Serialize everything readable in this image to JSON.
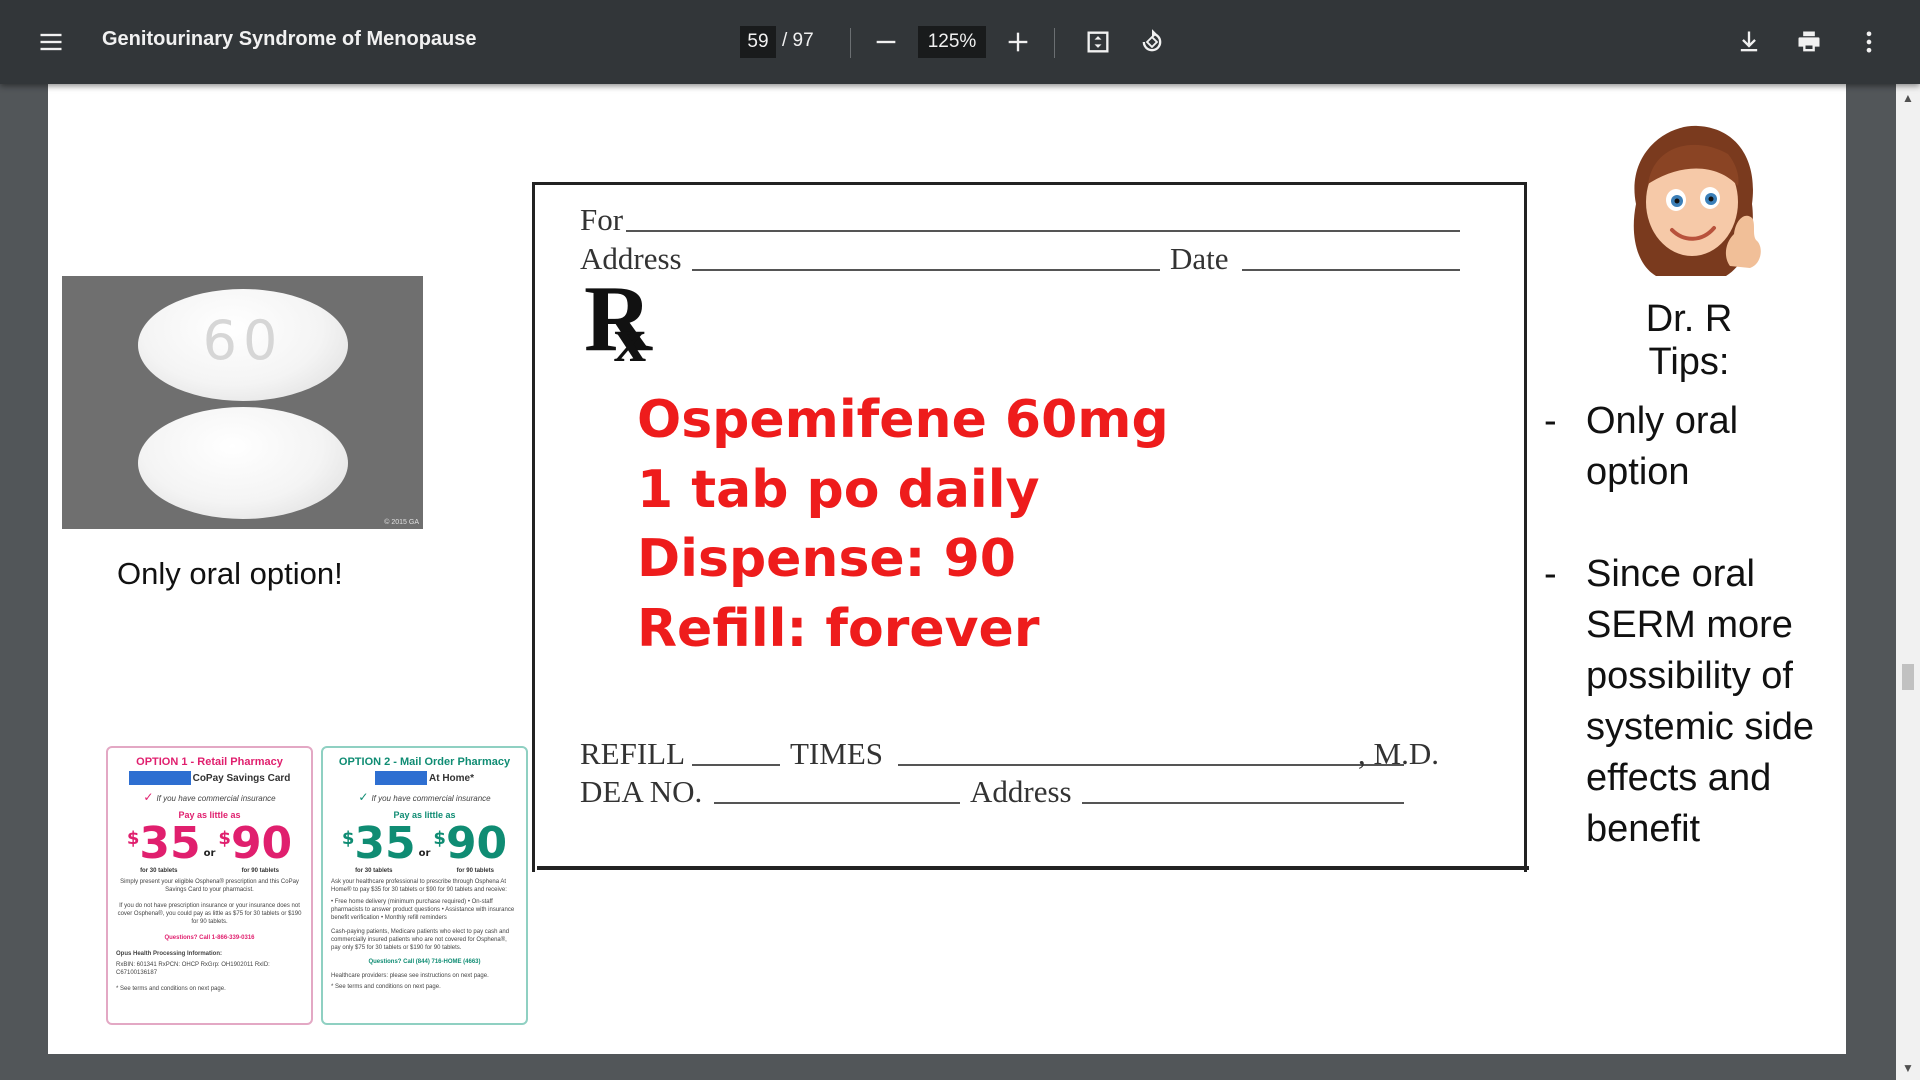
{
  "toolbar": {
    "menu_icon": "hamburger-menu-icon",
    "title": "Genitourinary Syndrome of Menopause",
    "current_page": "59",
    "total_pages": "/ 97",
    "zoom": "125%",
    "icons": [
      "zoom-out-icon",
      "zoom-in-icon",
      "fit-page-icon",
      "rotate-icon",
      "download-icon",
      "print-icon",
      "more-options-icon"
    ]
  },
  "slide": {
    "pill_photo": {
      "imprint": "60",
      "credit": "© 2015 GA"
    },
    "oral_caption": "Only oral option!",
    "rx_pad": {
      "for_label": "For",
      "address_label": "Address",
      "date_label": "Date",
      "rx_symbol": "R",
      "rx_symbol_x": "x",
      "refill_label": "REFILL",
      "times_label": "TIMES",
      "md_label": ", M.D.",
      "dea_label": "DEA NO.",
      "address2_label": "Address",
      "lines": [
        "Ospemifene 60mg",
        "1 tab po daily",
        "Dispense: 90",
        "Refill: forever"
      ]
    },
    "coupons": [
      {
        "title": "OPTION 1 - Retail Pharmacy",
        "subtitle": "CoPay Savings Card",
        "check": "If you have commercial insurance",
        "pay_label": "Pay as little as",
        "price1": "35",
        "price2": "90",
        "currency": "$",
        "or": "or",
        "tabs1": "for 30 tablets",
        "tabs2": "for 90 tablets",
        "fine1": "Simply present your eligible Osphena® prescription and this CoPay Savings Card to your pharmacist.",
        "fine2": "If you do not have prescription insurance or your insurance does not cover Osphena®, you could pay as little as $75 for 30 tablets or $190 for 90 tablets.",
        "questions": "Questions? Call 1-866-339-0316",
        "processing": "Opus Health Processing Information:",
        "ids": "RxBIN: 601341   RxPCN: OHCP   RxGrp: OH1902011   RxID: C67100136187",
        "terms": "* See terms and conditions on next page."
      },
      {
        "title": "OPTION 2 - Mail Order Pharmacy",
        "subtitle": "At Home*",
        "check": "If you have commercial insurance",
        "pay_label": "Pay as little as",
        "price1": "35",
        "price2": "90",
        "currency": "$",
        "or": "or",
        "tabs1": "for 30 tablets",
        "tabs2": "for 90 tablets",
        "fine1": "Ask your healthcare professional to prescribe through Osphena At Home® to pay $35 for 30 tablets or $90 for 90 tablets and receive:",
        "bullets": "• Free home delivery (minimum purchase required)  • On-staff pharmacists to answer product questions  • Assistance with insurance benefit verification  • Monthly refill reminders",
        "fine2": "Cash-paying patients, Medicare patients who elect to pay cash and commercially insured patients who are not covered for Osphena®, pay only $75 for 30 tablets or $190 for 90 tablets.",
        "questions": "Questions? Call (844) 716-HOME (4663)",
        "processing": "Healthcare providers: please see instructions on next page.",
        "terms": "* See terms and conditions on next page."
      }
    ],
    "avatar_icon": "memoji-thumbs-up-avatar-icon",
    "tips_heading": "Dr. R Tips:",
    "tips": [
      {
        "dash": "-",
        "text": "Only oral option"
      },
      {
        "dash": "-",
        "text": "Since oral SERM more possibility of systemic side effects and benefit"
      }
    ]
  },
  "colors": {
    "toolbar_bg": "#323639",
    "rx_text": "#ee1c1c",
    "coupon1_accent": "#e01f6e",
    "coupon2_accent": "#0f8c73"
  }
}
